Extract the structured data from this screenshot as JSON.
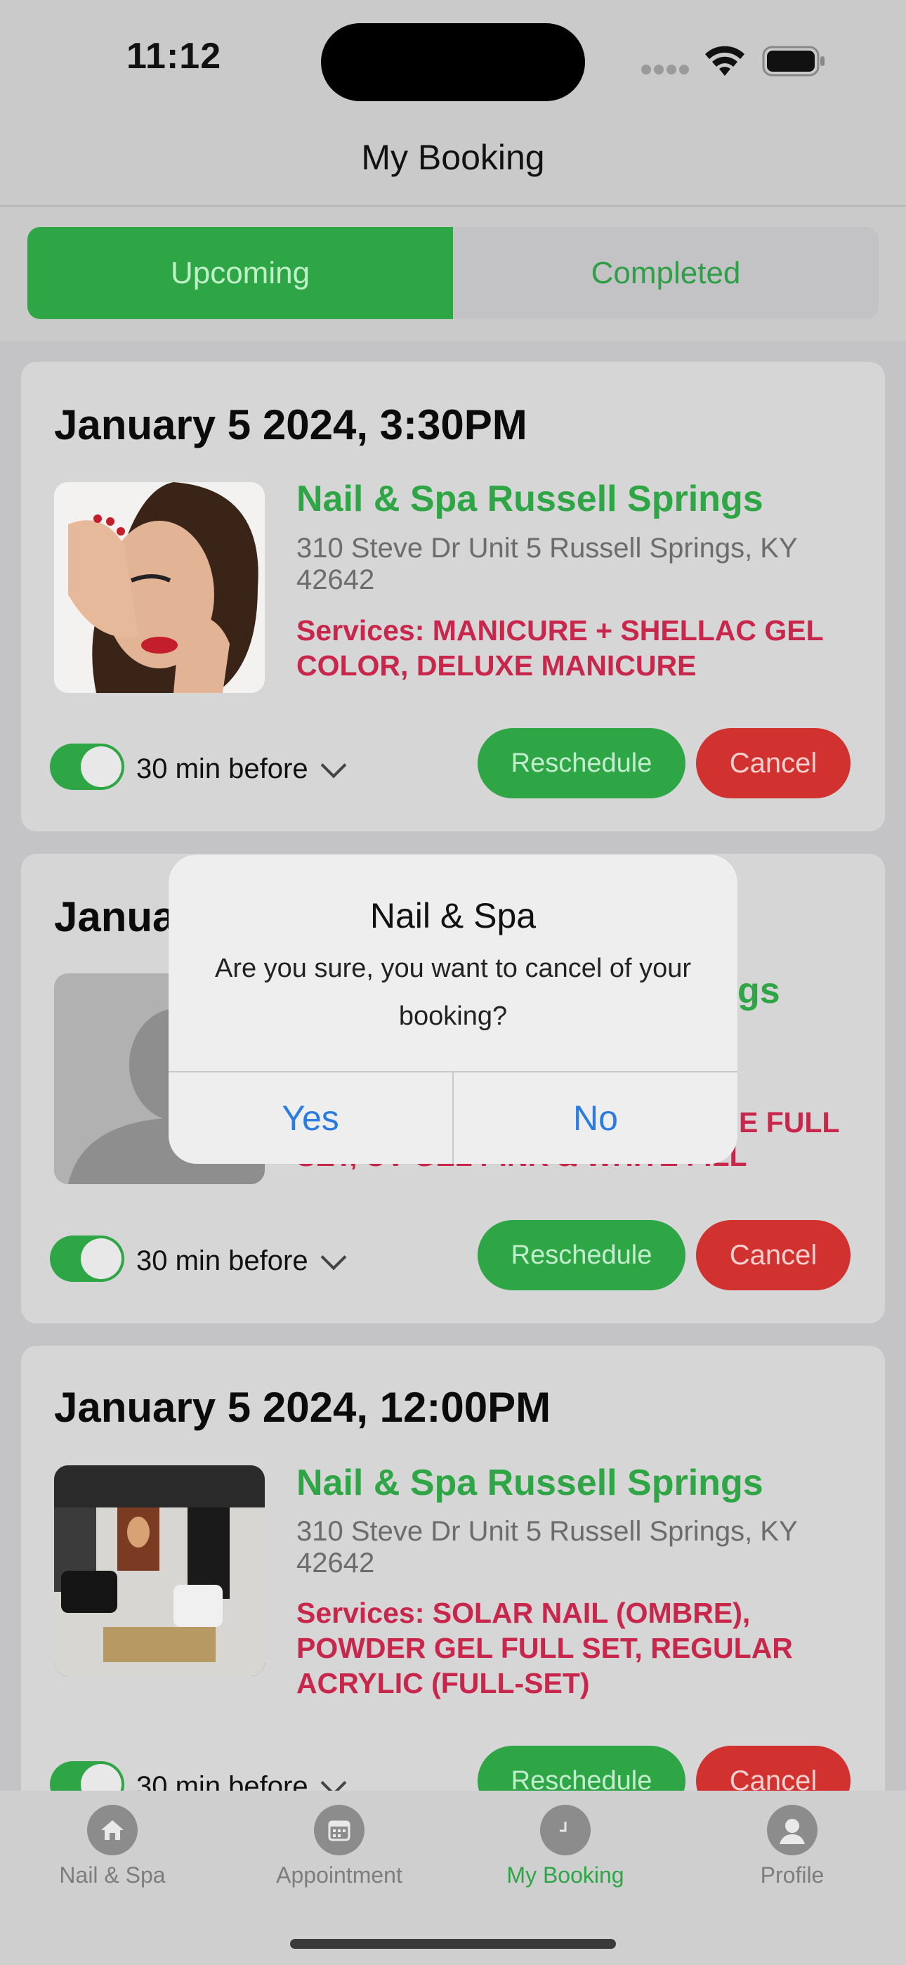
{
  "status": {
    "time": "11:12"
  },
  "header": {
    "title": "My Booking"
  },
  "tabs": {
    "upcoming": "Upcoming",
    "completed": "Completed"
  },
  "bookings": [
    {
      "date": "January 5 2024, 3:30PM",
      "salon": "Nail & Spa Russell Springs",
      "address": "310 Steve Dr Unit 5 Russell Springs, KY 42642",
      "services": "Services: MANICURE + SHELLAC GEL COLOR, DELUXE MANICURE",
      "reminder": "30 min before",
      "reschedule": "Reschedule",
      "cancel": "Cancel"
    },
    {
      "date": "Janua",
      "salon_partial": "gs",
      "services_partial_1": "E FULL",
      "services_partial_2": "SET, UV GEL PINK & WHITE FILL",
      "reminder": "30 min before",
      "reschedule": "Reschedule",
      "cancel": "Cancel"
    },
    {
      "date": "January 5 2024, 12:00PM",
      "salon": "Nail & Spa Russell Springs",
      "address": "310 Steve Dr Unit 5 Russell Springs, KY 42642",
      "services": "Services: SOLAR NAIL (OMBRE), POWDER GEL FULL SET, REGULAR ACRYLIC (FULL-SET)",
      "reminder": "30 min before",
      "reschedule": "Reschedule",
      "cancel": "Cancel"
    }
  ],
  "alert": {
    "title": "Nail & Spa",
    "message": "Are you sure, you want to cancel of your booking?",
    "yes": "Yes",
    "no": "No"
  },
  "tabbar": {
    "items": [
      "Nail & Spa",
      "Appointment",
      "My Booking",
      "Profile"
    ],
    "active_color": "#2ea646"
  }
}
